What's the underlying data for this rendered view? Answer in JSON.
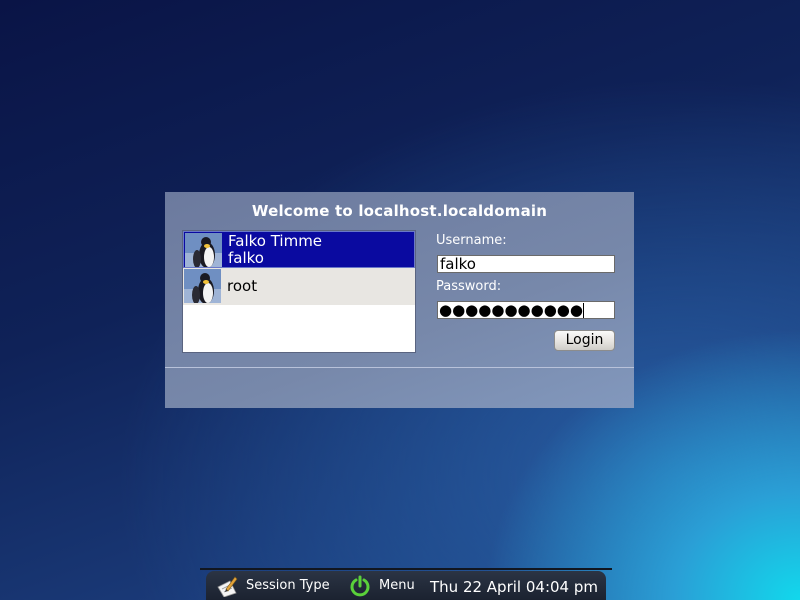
{
  "greeter": {
    "title": "Welcome to localhost.localdomain",
    "users": [
      {
        "full_name": "Falko Timme",
        "login": "falko",
        "selected": true
      },
      {
        "full_name": "",
        "login": "root",
        "selected": false
      }
    ],
    "username_label": "Username:",
    "username_value": "falko",
    "password_label": "Password:",
    "password_dots": "●●●●●●●●●●●",
    "login_button": "Login"
  },
  "bottom_bar": {
    "session_label": "Session Type",
    "menu_label": "Menu",
    "clock": "Thu 22 April 04:04 pm"
  }
}
